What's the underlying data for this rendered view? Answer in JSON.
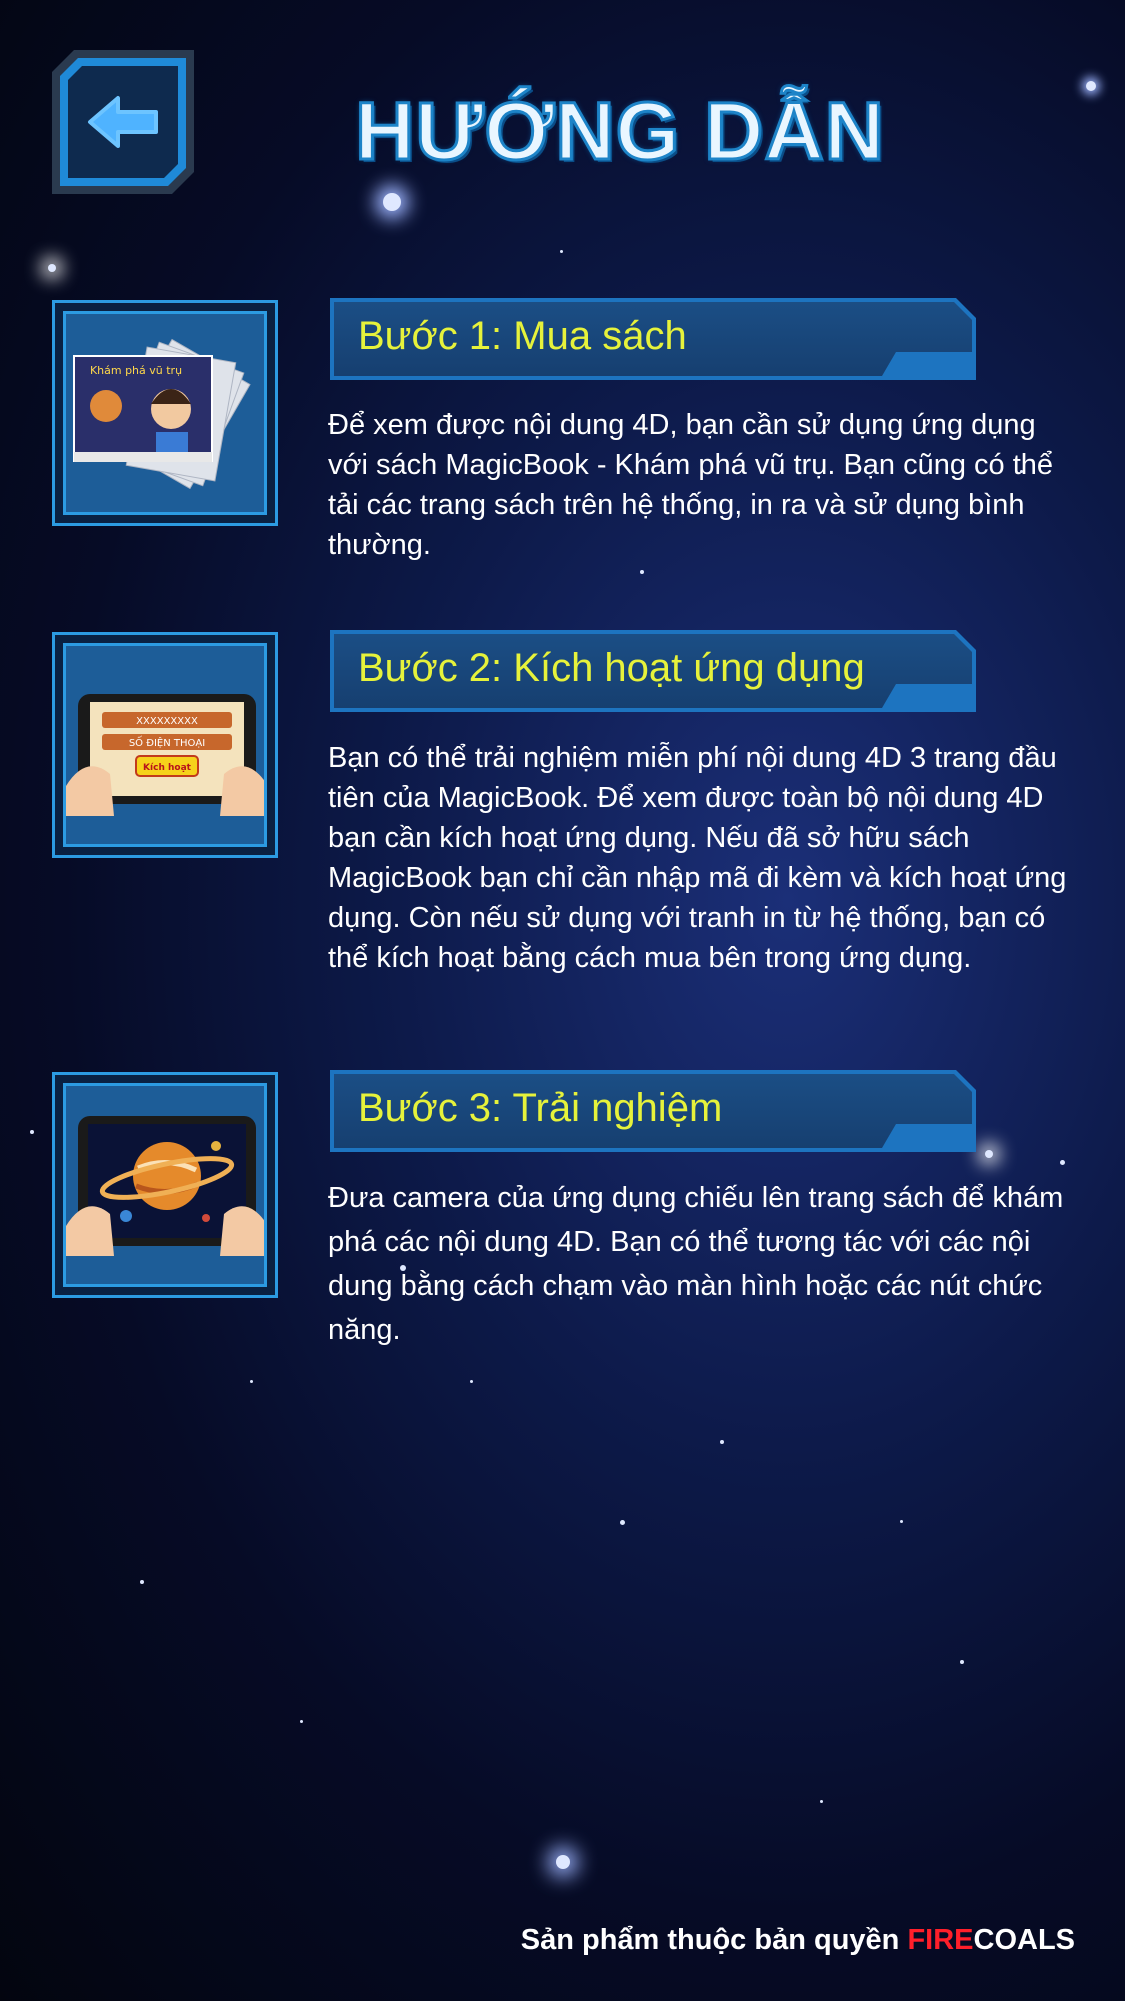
{
  "header": {
    "title": "HƯỚNG DẪN",
    "back_icon": "arrow-left-icon"
  },
  "steps": [
    {
      "title": "Bước 1: Mua sách",
      "text": "Để xem được nội dung 4D, bạn cần sử dụng ứng dụng với sách MagicBook - Khám phá vũ trụ. Bạn cũng có thể tải các trang sách trên hệ thống, in ra và sử dụng bình thường.",
      "image": "magicbook-pages-image",
      "book_cover_text": "Khám phá vũ trụ"
    },
    {
      "title": "Bước 2: Kích hoạt ứng dụng",
      "text": "Bạn có thể trải nghiệm miễn phí nội dung 4D 3 trang đầu tiên của MagicBook. Để xem được toàn bộ nội dung 4D bạn cần kích hoạt ứng dụng. Nếu đã sở hữu sách MagicBook bạn chỉ cần nhập mã đi kèm và kích hoạt ứng dụng. Còn nếu sử dụng với tranh in từ hệ thống, bạn có thể kích hoạt bằng cách mua bên trong ứng dụng.",
      "image": "activation-tablet-image",
      "field_code": "XXXXXXXXX",
      "field_phone": "SỐ ĐIỆN THOẠI",
      "activate_label": "Kích hoạt"
    },
    {
      "title": "Bước 3: Trải nghiệm",
      "text": "Đưa camera của ứng dụng chiếu lên trang sách để khám phá các nội dung 4D. Bạn có thể tương tác với các nội dung bằng cách chạm vào màn hình hoặc các nút chức năng.",
      "image": "planet-tablet-image"
    }
  ],
  "footer": {
    "prefix": "Sản phẩm thuộc bản quyền ",
    "brand_fire": "FIRE",
    "brand_coals": "COALS"
  },
  "colors": {
    "step_title": "#e6f23b",
    "accent_blue": "#2c9be2",
    "brand_red": "#ff1f2a"
  }
}
